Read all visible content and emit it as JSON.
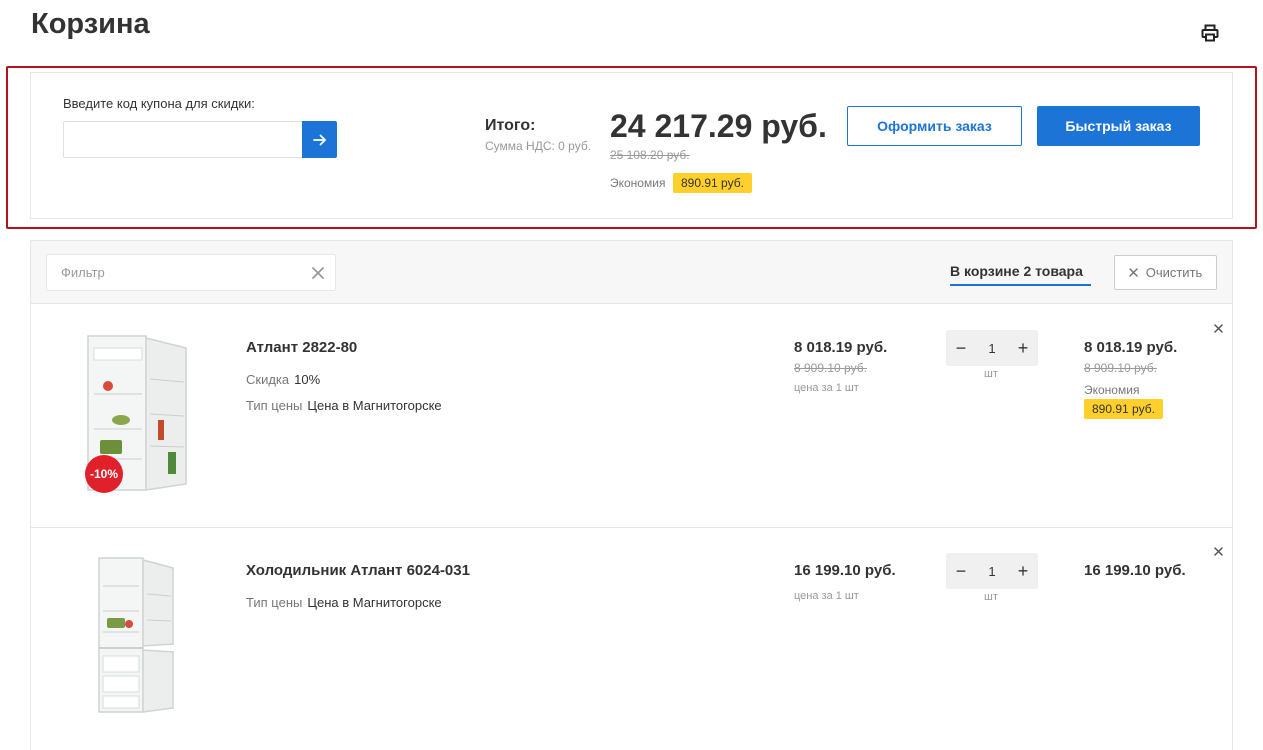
{
  "page": {
    "title": "Корзина"
  },
  "icons": {
    "print": "printer-icon",
    "submit": "arrow-right-icon",
    "clear": "close-icon"
  },
  "colors": {
    "accent": "#1b74d6",
    "economy": "#ffd02b",
    "discount": "#e0212b",
    "highlight": "#b3141c"
  },
  "coupon": {
    "label": "Введите код купона для скидки:",
    "value": ""
  },
  "summary": {
    "total_label": "Итого:",
    "vat": "Сумма НДС: 0 руб.",
    "total": "24 217.29 руб.",
    "total_old": "25 108.20 руб.",
    "economy_label": "Экономия",
    "economy_value": "890.91 руб."
  },
  "actions": {
    "checkout": "Оформить заказ",
    "quick_order": "Быстрый заказ"
  },
  "toolbar": {
    "filter_placeholder": "Фильтр",
    "cart_count": "В корзине 2 товара",
    "clear_label": "Очистить"
  },
  "items": [
    {
      "name": "Атлант 2822-80",
      "discount_label": "Скидка",
      "discount_value": "10%",
      "price_type_label": "Тип цены",
      "price_type": "Цена в Магнитогорске",
      "badge": "-10%",
      "price": "8 018.19 руб.",
      "price_old": "8 909.10 руб.",
      "price_per": "цена за 1 шт",
      "qty": "1",
      "unit": "шт",
      "sum": "8 018.19 руб.",
      "sum_old": "8 909.10 руб.",
      "economy_label": "Экономия",
      "economy_value": "890.91 руб.",
      "qty_minus": "−",
      "qty_plus": "+"
    },
    {
      "name": "Холодильник Атлант 6024-031",
      "price_type_label": "Тип цены",
      "price_type": "Цена в Магнитогорске",
      "price": "16 199.10 руб.",
      "price_per": "цена за 1 шт",
      "qty": "1",
      "unit": "шт",
      "sum": "16 199.10 руб.",
      "qty_minus": "−",
      "qty_plus": "+"
    }
  ]
}
